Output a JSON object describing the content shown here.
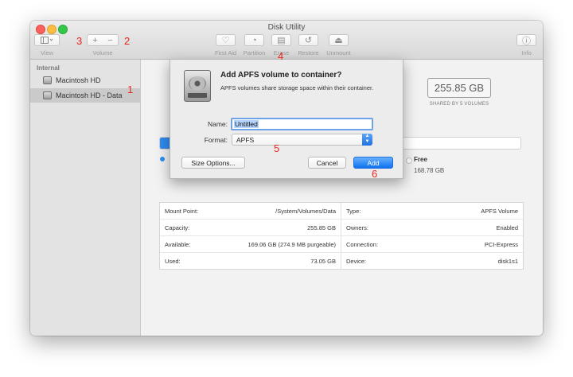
{
  "window": {
    "title": "Disk Utility"
  },
  "toolbar": {
    "view_label": "View",
    "volume_label": "Volume",
    "add_glyph": "+",
    "remove_glyph": "−",
    "first_aid_label": "First Aid",
    "partition_label": "Partition",
    "erase_label": "Erase",
    "restore_label": "Restore",
    "unmount_label": "Unmount",
    "info_label": "Info"
  },
  "sidebar": {
    "section": "Internal",
    "items": [
      {
        "label": "Macintosh HD"
      },
      {
        "label": "Macintosh HD - Data"
      }
    ]
  },
  "volume": {
    "capacity_display": "255.85 GB",
    "shared_caption": "SHARED BY 5 VOLUMES",
    "free_label": "Free",
    "free_value": "168.78 GB",
    "used_fraction": 0.29
  },
  "info": {
    "rows": [
      {
        "k": "Mount Point:",
        "v": "/System/Volumes/Data"
      },
      {
        "k": "Capacity:",
        "v": "255.85 GB"
      },
      {
        "k": "Available:",
        "v": "169.06 GB (274.9 MB purgeable)"
      },
      {
        "k": "Used:",
        "v": "73.05 GB"
      }
    ],
    "rows_right": [
      {
        "k": "Type:",
        "v": "APFS Volume"
      },
      {
        "k": "Owners:",
        "v": "Enabled"
      },
      {
        "k": "Connection:",
        "v": "PCI-Express"
      },
      {
        "k": "Device:",
        "v": "disk1s1"
      }
    ]
  },
  "dialog": {
    "title": "Add APFS volume to container?",
    "description": "APFS volumes share storage space within their container.",
    "name_label": "Name:",
    "name_value": "Untitled",
    "format_label": "Format:",
    "format_value": "APFS",
    "size_options_label": "Size Options...",
    "cancel_label": "Cancel",
    "add_label": "Add"
  },
  "annotations": [
    "1",
    "2",
    "3",
    "4",
    "5",
    "6"
  ],
  "colors": {
    "accent": "#2f8cf0",
    "annotation": "#e8241f"
  }
}
